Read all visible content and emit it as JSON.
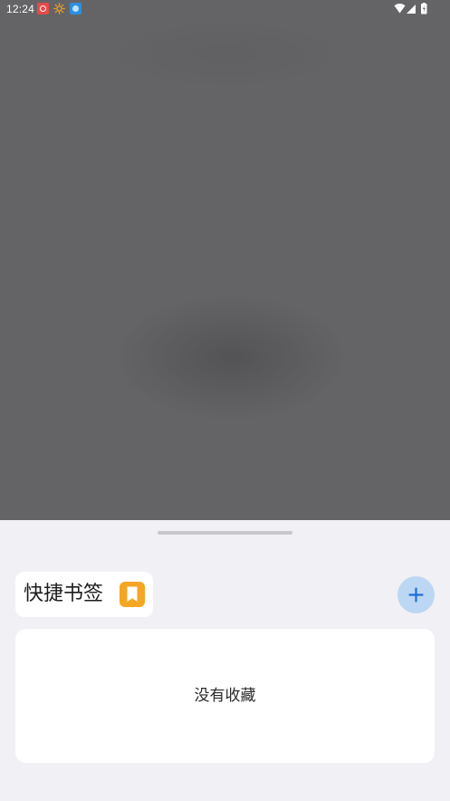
{
  "status_bar": {
    "time": "12:24",
    "notification_icons": [
      "app-red-icon",
      "sun-icon",
      "app-blue-icon"
    ],
    "system_icons": [
      "wifi-icon",
      "cell-signal-icon",
      "battery-icon"
    ]
  },
  "sheet": {
    "title": "快捷书签",
    "title_icon": "bookmark-icon",
    "add_button_icon": "plus-icon",
    "empty_message": "没有收藏"
  },
  "colors": {
    "scrim": "#646466",
    "sheet_background": "#f1f0f5",
    "card_background": "#ffffff",
    "bookmark_badge": "#f5a623",
    "add_button_background": "#bcd7f3",
    "add_button_glyph": "#1f6fd6"
  }
}
